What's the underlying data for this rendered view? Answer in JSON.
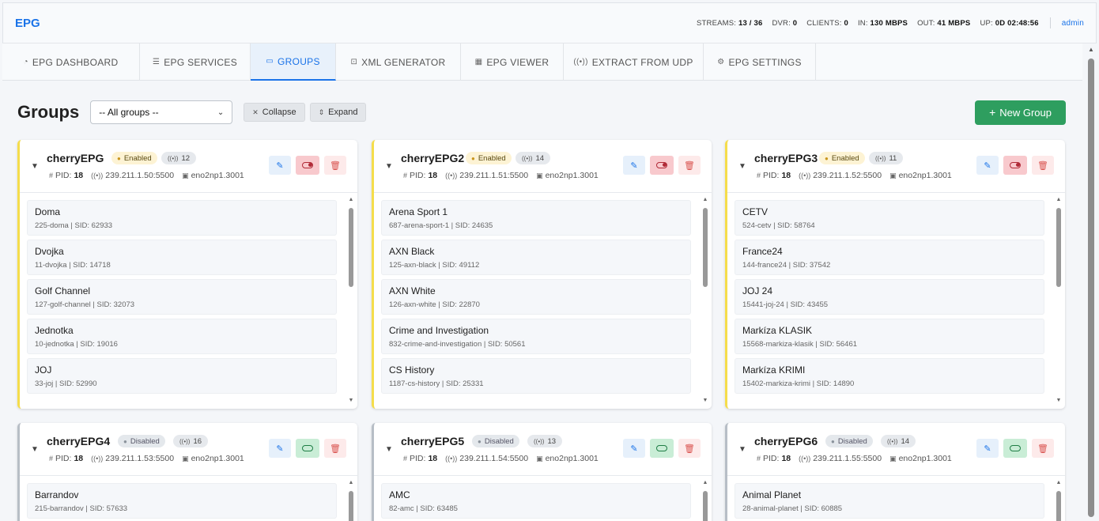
{
  "header": {
    "brand": "EPG",
    "stats": [
      {
        "label": "STREAMS:",
        "value": "13 / 36"
      },
      {
        "label": "DVR:",
        "value": "0"
      },
      {
        "label": "CLIENTS:",
        "value": "0"
      },
      {
        "label": "IN:",
        "value": "130 MBPS"
      },
      {
        "label": "OUT:",
        "value": "41 MBPS"
      },
      {
        "label": "UP:",
        "value": "0D 02:48:56"
      }
    ],
    "user": "admin"
  },
  "tabs": [
    {
      "label": "EPG DASHBOARD",
      "icon": "gauge-icon"
    },
    {
      "label": "EPG SERVICES",
      "icon": "list-icon"
    },
    {
      "label": "GROUPS",
      "icon": "folder-icon"
    },
    {
      "label": "XML GENERATOR",
      "icon": "file-code-icon"
    },
    {
      "label": "EPG VIEWER",
      "icon": "calendar-icon"
    },
    {
      "label": "EXTRACT FROM UDP",
      "icon": "broadcast-icon"
    },
    {
      "label": "EPG SETTINGS",
      "icon": "gear-icon"
    }
  ],
  "toolbar": {
    "title": "Groups",
    "select_value": "-- All groups --",
    "collapse_label": "Collapse",
    "expand_label": "Expand",
    "new_group_label": "New Group"
  },
  "groups": [
    {
      "name": "cherryEPG",
      "status": "Enabled",
      "count": "12",
      "pid_label": "PID:",
      "pid": "18",
      "address": "239.211.1.50:5500",
      "iface": "eno2np1.3001",
      "services": [
        {
          "name": "Doma",
          "sub": "225-doma | SID: 62933"
        },
        {
          "name": "Dvojka",
          "sub": "11-dvojka | SID: 14718"
        },
        {
          "name": "Golf Channel",
          "sub": "127-golf-channel | SID: 32073"
        },
        {
          "name": "Jednotka",
          "sub": "10-jednotka | SID: 19016"
        },
        {
          "name": "JOJ",
          "sub": "33-joj | SID: 52990"
        }
      ]
    },
    {
      "name": "cherryEPG2",
      "status": "Enabled",
      "count": "14",
      "pid_label": "PID:",
      "pid": "18",
      "address": "239.211.1.51:5500",
      "iface": "eno2np1.3001",
      "services": [
        {
          "name": "Arena Sport 1",
          "sub": "687-arena-sport-1 | SID: 24635"
        },
        {
          "name": "AXN Black",
          "sub": "125-axn-black | SID: 49112"
        },
        {
          "name": "AXN White",
          "sub": "126-axn-white | SID: 22870"
        },
        {
          "name": "Crime and Investigation",
          "sub": "832-crime-and-investigation | SID: 50561"
        },
        {
          "name": "CS History",
          "sub": "1187-cs-history | SID: 25331"
        }
      ]
    },
    {
      "name": "cherryEPG3",
      "status": "Enabled",
      "count": "11",
      "pid_label": "PID:",
      "pid": "18",
      "address": "239.211.1.52:5500",
      "iface": "eno2np1.3001",
      "services": [
        {
          "name": "CETV",
          "sub": "524-cetv | SID: 58764"
        },
        {
          "name": "France24",
          "sub": "144-france24 | SID: 37542"
        },
        {
          "name": "JOJ 24",
          "sub": "15441-joj-24 | SID: 43455"
        },
        {
          "name": "Markíza KLASIK",
          "sub": "15568-markiza-klasik | SID: 56461"
        },
        {
          "name": "Markíza KRIMI",
          "sub": "15402-markiza-krimi | SID: 14890"
        }
      ]
    },
    {
      "name": "cherryEPG4",
      "status": "Disabled",
      "count": "16",
      "pid_label": "PID:",
      "pid": "18",
      "address": "239.211.1.53:5500",
      "iface": "eno2np1.3001",
      "services": [
        {
          "name": "Barrandov",
          "sub": "215-barrandov | SID: 57633"
        }
      ]
    },
    {
      "name": "cherryEPG5",
      "status": "Disabled",
      "count": "13",
      "pid_label": "PID:",
      "pid": "18",
      "address": "239.211.1.54:5500",
      "iface": "eno2np1.3001",
      "services": [
        {
          "name": "AMC",
          "sub": "82-amc | SID: 63485"
        }
      ]
    },
    {
      "name": "cherryEPG6",
      "status": "Disabled",
      "count": "14",
      "pid_label": "PID:",
      "pid": "18",
      "address": "239.211.1.55:5500",
      "iface": "eno2np1.3001",
      "services": [
        {
          "name": "Animal Planet",
          "sub": "28-animal-planet | SID: 60885"
        }
      ]
    }
  ]
}
